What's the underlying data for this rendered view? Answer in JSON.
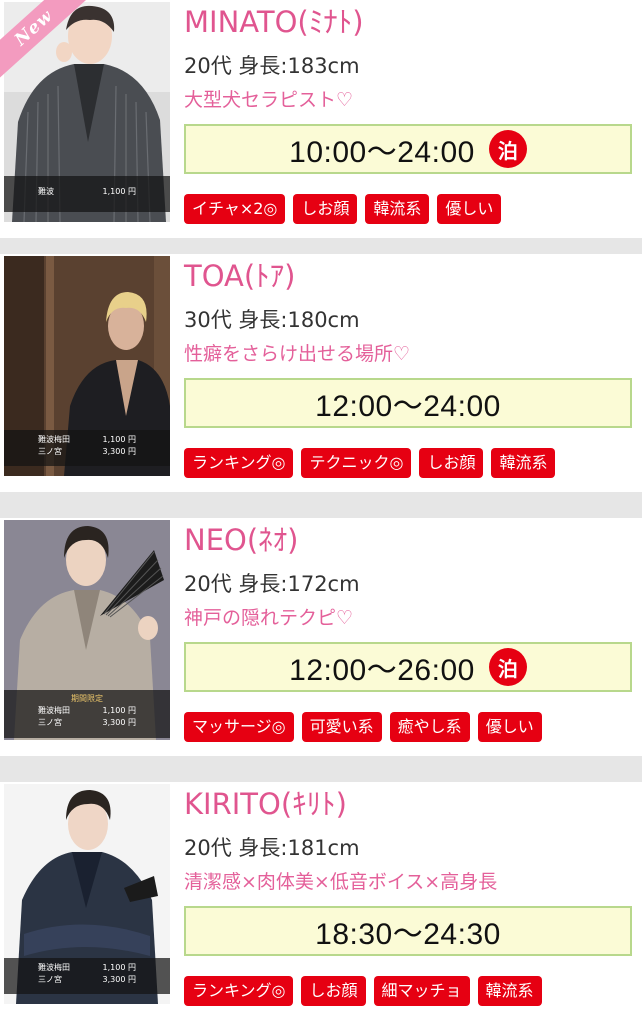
{
  "casts": [
    {
      "name": "MINATO(ﾐﾅﾄ)",
      "profile": "20代 身長:183cm",
      "catch": "大型犬セラピスト♡",
      "hours": "10:00〜24:00",
      "stay_badge": "泊",
      "ribbon": "New",
      "price_head": "",
      "prices": [
        {
          "area": "難波",
          "price": "1,100 円"
        }
      ],
      "tags": [
        "イチャ×2◎",
        "しお顔",
        "韓流系",
        "優しい"
      ]
    },
    {
      "name": "TOA(ﾄｱ)",
      "profile": "30代 身長:180cm",
      "catch": "性癖をさらけ出せる場所♡",
      "hours": "12:00〜24:00",
      "stay_badge": "",
      "ribbon": "",
      "price_head": "",
      "prices": [
        {
          "area": "難波梅田",
          "price": "1,100 円"
        },
        {
          "area": "三ノ宮",
          "price": "3,300 円"
        }
      ],
      "tags": [
        "ランキング◎",
        "テクニック◎",
        "しお顔",
        "韓流系"
      ]
    },
    {
      "name": "NEO(ﾈｵ)",
      "profile": "20代 身長:172cm",
      "catch": "神戸の隠れテクピ♡",
      "hours": "12:00〜26:00",
      "stay_badge": "泊",
      "ribbon": "",
      "price_head": "期間限定",
      "prices": [
        {
          "area": "難波梅田",
          "price": "1,100 円"
        },
        {
          "area": "三ノ宮",
          "price": "3,300 円"
        }
      ],
      "tags": [
        "マッサージ◎",
        "可愛い系",
        "癒やし系",
        "優しい"
      ]
    },
    {
      "name": "KIRITO(ｷﾘﾄ)",
      "profile": "20代 身長:181cm",
      "catch": "清潔感×肉体美×低音ボイス×高身長",
      "hours": "18:30〜24:30",
      "stay_badge": "",
      "ribbon": "",
      "price_head": "",
      "prices": [
        {
          "area": "難波梅田",
          "price": "1,100 円"
        },
        {
          "area": "三ノ宮",
          "price": "3,300 円"
        }
      ],
      "tags": [
        "ランキング◎",
        "しお顔",
        "細マッチョ",
        "韓流系"
      ]
    }
  ],
  "colors": {
    "name": "#e0558f",
    "catch": "#e4609a",
    "tag_bg": "#e60012",
    "hours_bg": "#fbfbd6",
    "hours_border": "#b8d88c",
    "ribbon": "#f39bbf"
  },
  "icons": {
    "stay": "stay-badge-icon",
    "photo": "therapist-photo"
  }
}
